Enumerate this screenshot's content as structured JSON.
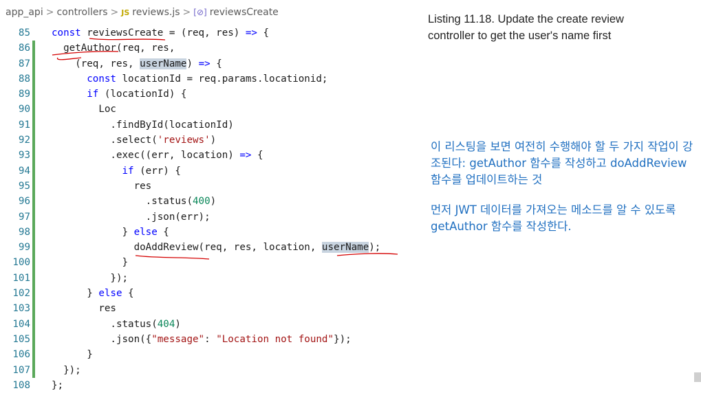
{
  "breadcrumb": {
    "folder1": "app_api",
    "folder2": "controllers",
    "file_icon": "JS",
    "file": "reviews.js",
    "symbol_icon": "[⊘]",
    "symbol": "reviewsCreate",
    "separator": ">"
  },
  "code_lines": [
    {
      "n": "85",
      "text": "const reviewsCreate = (req, res) => {"
    },
    {
      "n": "86",
      "text": "  getAuthor(req, res,"
    },
    {
      "n": "87",
      "text": "    (req, res, userName) => {"
    },
    {
      "n": "88",
      "text": "      const locationId = req.params.locationid;"
    },
    {
      "n": "89",
      "text": "      if (locationId) {"
    },
    {
      "n": "90",
      "text": "        Loc"
    },
    {
      "n": "91",
      "text": "          .findById(locationId)"
    },
    {
      "n": "92",
      "text": "          .select('reviews')"
    },
    {
      "n": "93",
      "text": "          .exec((err, location) => {"
    },
    {
      "n": "94",
      "text": "            if (err) {"
    },
    {
      "n": "95",
      "text": "              res"
    },
    {
      "n": "96",
      "text": "                .status(400)"
    },
    {
      "n": "97",
      "text": "                .json(err);"
    },
    {
      "n": "98",
      "text": "            } else {"
    },
    {
      "n": "99",
      "text": "              doAddReview(req, res, location, userName);"
    },
    {
      "n": "100",
      "text": "            }"
    },
    {
      "n": "101",
      "text": "          });"
    },
    {
      "n": "102",
      "text": "      } else {"
    },
    {
      "n": "103",
      "text": "        res"
    },
    {
      "n": "104",
      "text": "          .status(404)"
    },
    {
      "n": "105",
      "text": "          .json({\"message\": \"Location not found\"});"
    },
    {
      "n": "106",
      "text": "      }"
    },
    {
      "n": "107",
      "text": "  });"
    },
    {
      "n": "108",
      "text": "};"
    }
  ],
  "notes": {
    "listing_caption": "Listing 11.18. Update the create review controller to get the user's name first",
    "korean_1": "이 리스팅을 보면 여전히 수행해야 할 두 가지 작업이 강조된다: getAuthor 함수를 작성하고 doAddReview 함수를 업데이트하는 것",
    "korean_2": "먼저 JWT 데이터를 가져오는 메소드를 알 수 있도록 getAuthor 함수를 작성한다."
  },
  "colors": {
    "keyword": "#0000ff",
    "string": "#a31515",
    "number": "#098658",
    "line_number": "#237893",
    "gutter_modified": "#5aa85a",
    "annotation_ink": "#d40000",
    "korean_note": "#1f6fc0"
  }
}
